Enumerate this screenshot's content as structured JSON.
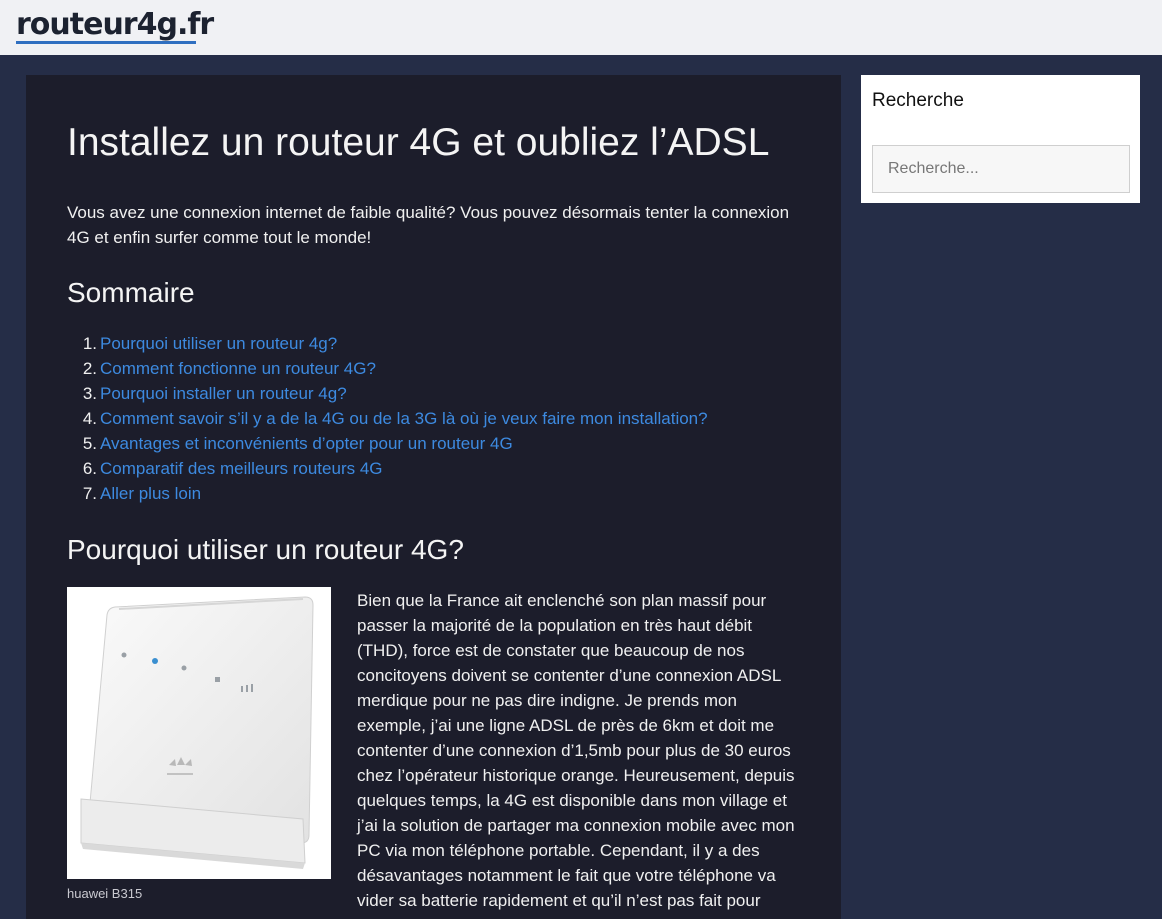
{
  "site": {
    "logo": "routeur4g.fr"
  },
  "article": {
    "title": "Installez un routeur 4G et oubliez l’ADSL",
    "intro": "Vous avez une connexion internet de faible qualité? Vous pouvez désormais tenter la connexion 4G et enfin surfer comme tout le monde!",
    "toc_heading": "Sommaire",
    "toc": [
      {
        "num": "1.",
        "label": "Pourquoi utiliser un routeur 4g?"
      },
      {
        "num": "2.",
        "label": "Comment fonctionne un routeur 4G?"
      },
      {
        "num": "3.",
        "label": "Pourquoi installer un routeur 4g?"
      },
      {
        "num": "4.",
        "label": "Comment savoir s’il y a de la 4G ou de la 3G là où je veux faire mon installation?"
      },
      {
        "num": "5.",
        "label": "Avantages et inconvénients d’opter pour un routeur 4G"
      },
      {
        "num": "6.",
        "label": "Comparatif des meilleurs routeurs 4G"
      },
      {
        "num": "7.",
        "label": "Aller plus loin"
      }
    ],
    "section1_heading": "Pourquoi utiliser un routeur 4G?",
    "image_caption": "huawei B315",
    "image_brand_mark": "HUAWEI",
    "section1_body": "Bien que la France ait enclenché son plan massif pour passer la majorité de la population en très haut débit (THD), force est de constater que beaucoup de nos concitoyens doivent se contenter d’une connexion ADSL merdique pour ne pas dire indigne. Je prends mon exemple, j’ai une ligne ADSL de près de 6km et doit me contenter d’une connexion d’1,5mb pour plus de 30 euros chez l’opérateur historique orange. Heureusement, depuis quelques temps, la 4G est disponible dans mon village et j’ai la solution de partager ma connexion mobile avec mon PC via mon téléphone portable. Cependant, il y a des désavantages notamment le fait que votre téléphone va vider sa batterie rapidement et qu’il n’est pas fait pour"
  },
  "sidebar": {
    "widget_title": "Recherche",
    "search_placeholder": "Recherche..."
  },
  "colors": {
    "page_bg": "#252d47",
    "header_bg": "#f0f1f4",
    "article_bg": "#1c1d2b",
    "link": "#3d8ae0",
    "logo_underline": "#2f6fc0"
  }
}
